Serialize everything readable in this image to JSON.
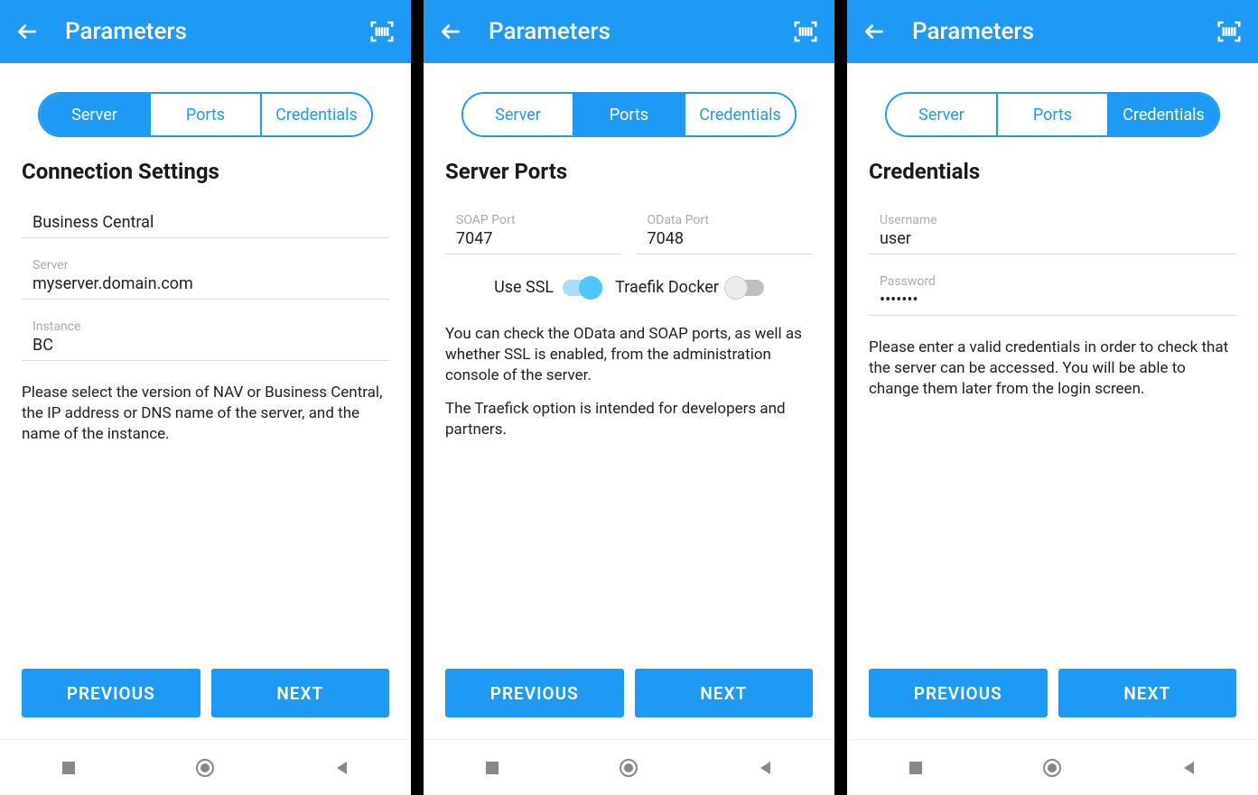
{
  "header": {
    "title": "Parameters"
  },
  "tabs": {
    "server": "Server",
    "ports": "Ports",
    "credentials": "Credentials"
  },
  "buttons": {
    "previous": "PREVIOUS",
    "next": "NEXT"
  },
  "screen1": {
    "section": "Connection Settings",
    "version_value": "Business Central",
    "server_label": "Server",
    "server_value": "myserver.domain.com",
    "instance_label": "Instance",
    "instance_value": "BC",
    "help": "Please select the version of NAV or Business Central, the IP address or DNS name of the server, and the name of the instance."
  },
  "screen2": {
    "section": "Server Ports",
    "soap_label": "SOAP Port",
    "soap_value": "7047",
    "odata_label": "OData Port",
    "odata_value": "7048",
    "ssl_label": "Use SSL",
    "ssl_on": true,
    "traefik_label": "Traefik Docker",
    "traefik_on": false,
    "help1": "You can check the OData and SOAP ports, as well as whether SSL is enabled, from the administration console of the server.",
    "help2": "The Traefick option is intended for developers and partners."
  },
  "screen3": {
    "section": "Credentials",
    "username_label": "Username",
    "username_value": "user",
    "password_label": "Password",
    "password_value": "•••••••",
    "help": "Please enter a valid credentials in order to check that the server can be accessed. You will be able to change them later from the login screen."
  }
}
